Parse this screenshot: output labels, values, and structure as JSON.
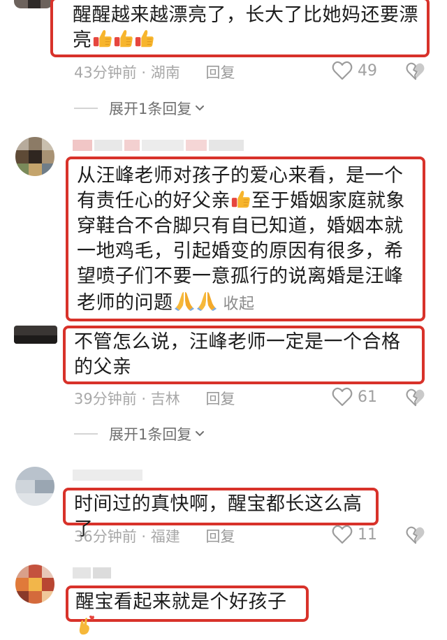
{
  "comments": [
    {
      "text": "醒醒越来越漂亮了，长大了比她妈还要漂亮",
      "time": "43分钟前",
      "location": "湖南",
      "reply_label": "回复",
      "likes": "49",
      "expand_label": "展开1条回复"
    },
    {
      "text": "从汪峰老师对孩子的爱心来看，是一个有责任心的好父亲",
      "text_cont": "至于婚姻家庭就象穿鞋合不合脚只有自已知道，婚姻本就一地鸡毛，引起婚变的原因有很多，希望喷子们不要一意孤行的说离婚是汪峰老师的问题",
      "collapse_label": "收起"
    },
    {
      "text": "不管怎么说，汪峰老师一定是一个合格的父亲",
      "time": "39分钟前",
      "location": "吉林",
      "reply_label": "回复",
      "likes": "61",
      "expand_label": "展开1条回复"
    },
    {
      "text": "时间过的真快啊，醒宝都长这么高了",
      "time": "36分钟前",
      "location": "福建",
      "reply_label": "回复",
      "likes": "11"
    },
    {
      "text": "醒宝看起来就是个好孩子"
    }
  ],
  "colors": {
    "highlight": "#d8322a",
    "meta_text": "#a8a8a8",
    "body_text": "#1c1c1c"
  },
  "icons": [
    "thumbs-up-icon",
    "heart-icon",
    "broken-heart-icon",
    "folded-hands-icon",
    "crossed-fingers-heart-icon",
    "chevron-down-icon"
  ]
}
